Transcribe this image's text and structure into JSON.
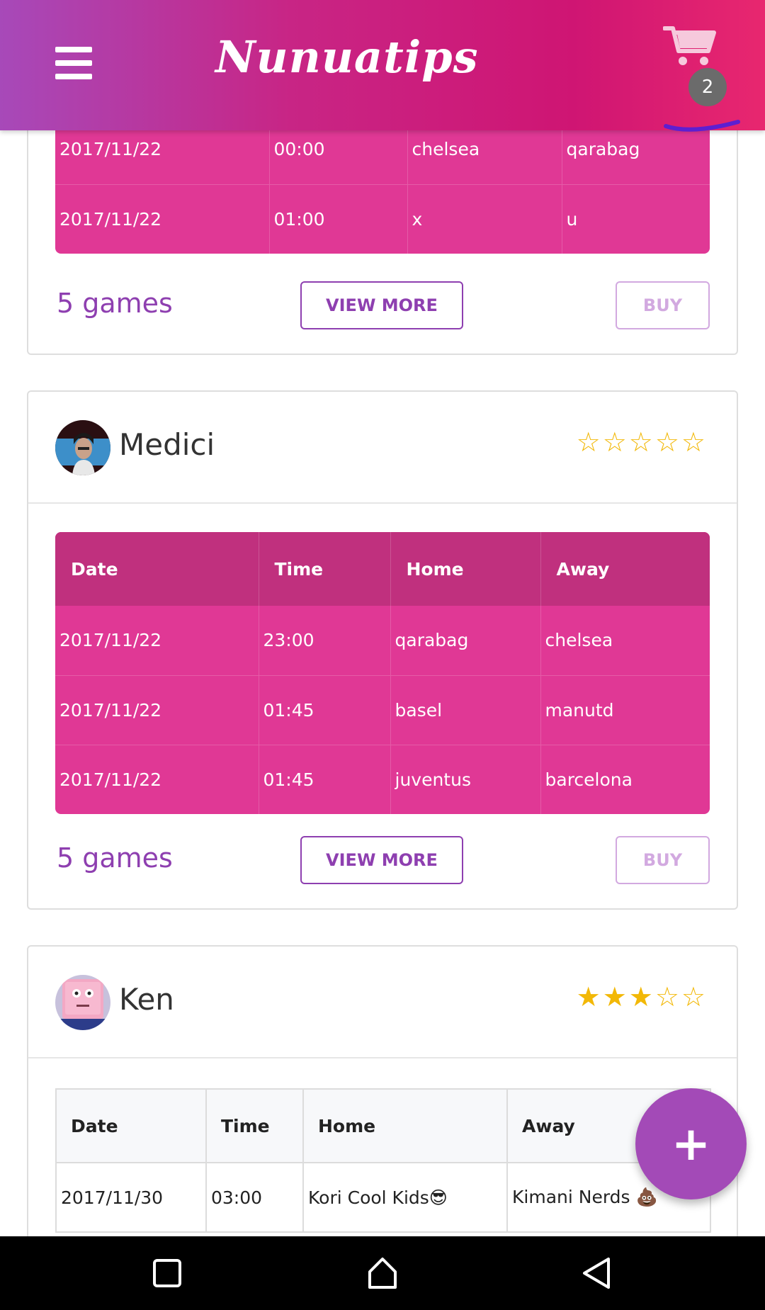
{
  "app": {
    "title": "Nunuatips",
    "cart_count": "2",
    "menu_icon": "hamburger-menu-icon",
    "cart_icon": "shopping-cart-icon",
    "fab_label": "+",
    "colors": {
      "primary": "#8e3fb0",
      "accent": "#cf1573",
      "table_pink": "#e03895",
      "star": "#f2b807"
    }
  },
  "cards": [
    {
      "tipster": null,
      "rows": [
        [
          "2017/11/22",
          "00:00",
          "chelsea",
          "qarabag"
        ],
        [
          "2017/11/22",
          "01:00",
          "x",
          "u"
        ]
      ],
      "games_count": "5 games",
      "view_more": "VIEW MORE",
      "buy": "BUY"
    },
    {
      "tipster": "Medici",
      "rating": 0,
      "headers": [
        "Date",
        "Time",
        "Home",
        "Away"
      ],
      "rows": [
        [
          "2017/11/22",
          "23:00",
          "qarabag",
          "chelsea"
        ],
        [
          "2017/11/22",
          "01:45",
          "basel",
          "manutd"
        ],
        [
          "2017/11/22",
          "01:45",
          "juventus",
          "barcelona"
        ]
      ],
      "games_count": "5 games",
      "view_more": "VIEW MORE",
      "buy": "BUY"
    },
    {
      "tipster": "Ken",
      "rating": 3,
      "headers": [
        "Date",
        "Time",
        "Home",
        "Away"
      ],
      "rows": [
        [
          "2017/11/30",
          "03:00",
          "Kori Cool Kids😎",
          "Kimani Nerds 💩"
        ]
      ]
    }
  ],
  "navbar": [
    "recent-apps-icon",
    "home-icon",
    "back-icon"
  ]
}
